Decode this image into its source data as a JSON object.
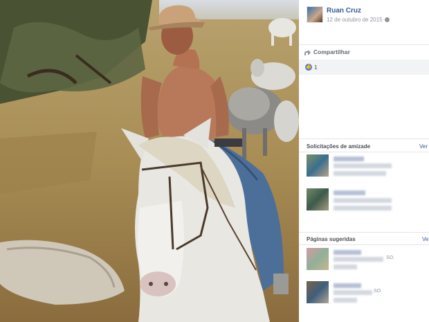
{
  "post": {
    "author": "Ruan Cruz",
    "date": "12 de outubro de 2015",
    "share_label": "Compartilhar",
    "like_count": "1"
  },
  "friend_requests": {
    "title": "Solicitações de amizade",
    "see_all": "Ver t"
  },
  "suggested_pages": {
    "title": "Páginas sugeridas",
    "see_all": "Ver",
    "items": [
      {
        "suffix": "SO."
      },
      {
        "suffix": "SO."
      }
    ]
  },
  "icons": [
    "globe-icon",
    "share-icon",
    "like-icon"
  ],
  "colors": {
    "link": "#365899",
    "like": "#4a7bd8",
    "muted": "#90949c"
  }
}
